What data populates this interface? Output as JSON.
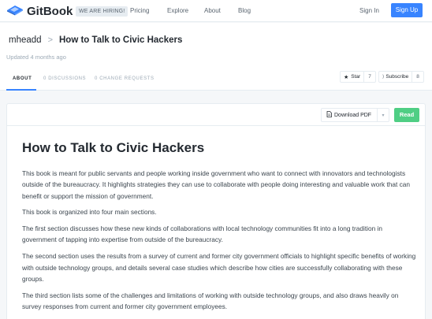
{
  "nav": {
    "brand": "GitBook",
    "hiring_badge": "WE ARE HIRING!",
    "links": [
      "Pricing",
      "Explore",
      "About",
      "Blog"
    ],
    "signin": "Sign In",
    "signup": "Sign Up"
  },
  "header": {
    "user": "mheadd",
    "separator": ">",
    "book_title": "How to Talk to Civic Hackers",
    "updated": "Updated 4 months ago",
    "tabs": [
      {
        "label": "ABOUT"
      },
      {
        "label": "0 DISCUSSIONS"
      },
      {
        "label": "0 CHANGE REQUESTS"
      }
    ],
    "star": {
      "label": "Star",
      "count": "7"
    },
    "subscribe": {
      "label": "Subscribe",
      "count": "8"
    }
  },
  "toolbar": {
    "download_label": "Download PDF",
    "read_label": "Read"
  },
  "content": {
    "title": "How to Talk to Civic Hackers",
    "paragraphs": [
      "This book is meant for public servants and people working inside government who want to connect with innovators and technologists outside of the bureaucracy. It highlights strategies they can use to collaborate with people doing interesting and valuable work that can benefit or support the mission of government.",
      "This book is organized into four main sections.",
      "The first section discusses how these new kinds of collaborations with local technology communities fit into a long tradition in government of tapping into expertise from outside of the bureaucracy.",
      "The second section uses the results from a survey of current and former city government officials to highlight specific benefits of working with outside technology groups, and details several case studies which describe how cities are successfully collaborating with these groups.",
      "The third section lists some of the challenges and limitations of working with outside technology groups, and also draws heavily on survey responses from current and former city government employees."
    ]
  },
  "colors": {
    "accent": "#3884ff",
    "read_button": "#4fce84",
    "text": "#242a31"
  }
}
